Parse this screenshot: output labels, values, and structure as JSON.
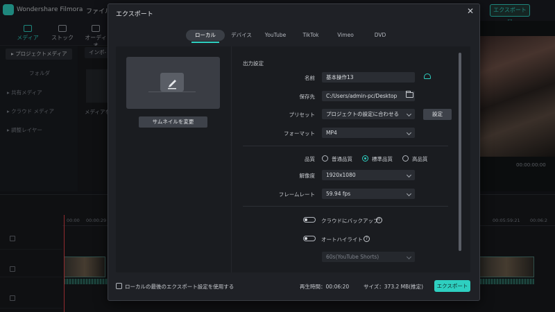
{
  "app": {
    "title": "Wondershare Filmora",
    "menu_file": "ファイル",
    "export_top": "エクスポート ▽"
  },
  "toolbar": {
    "media": "メディア",
    "stock": "ストック",
    "audio": "オーディオ"
  },
  "sidebar": {
    "items": [
      {
        "label": "▸ プロジェクトメディア"
      },
      {
        "label": "フォルダ"
      },
      {
        "label": "▸ 共有メディア"
      },
      {
        "label": "▸ クラウド メディア"
      },
      {
        "label": "▸ 調整レイヤー"
      }
    ]
  },
  "media_panel": {
    "import": "インポ-",
    "drop_hint": "メディアを"
  },
  "preview": {
    "timecode": "00:00:00:00"
  },
  "timeline": {
    "times": [
      "00:00",
      "00:00:29",
      "00:05:59:21",
      "00:06:2"
    ]
  },
  "dialog": {
    "title": "エクスポート",
    "close": "✕",
    "tabs": [
      {
        "label": "ローカル",
        "active": true
      },
      {
        "label": "デバイス"
      },
      {
        "label": "YouTube"
      },
      {
        "label": "TikTok"
      },
      {
        "label": "Vimeo"
      },
      {
        "label": "DVD"
      }
    ],
    "thumbnail_button": "サムネイルを変更",
    "section_title": "出力設定",
    "fields": {
      "name_label": "名前",
      "name_value": "基本操作13",
      "save_label": "保存先",
      "save_value": "C:/Users/admin-pc/Desktop",
      "preset_label": "プリセット",
      "preset_value": "プロジェクトの設定に合わせる",
      "settings_button": "設定",
      "format_label": "フォーマット",
      "format_value": "MP4",
      "quality_label": "品質",
      "quality_options": [
        "普通品質",
        "標準品質",
        "高品質"
      ],
      "quality_selected": "標準品質",
      "resolution_label": "解像度",
      "resolution_value": "1920x1080",
      "framerate_label": "フレームレート",
      "framerate_value": "59.94 fps",
      "cloud_backup_label": "クラウドにバックアップ",
      "auto_highlight_label": "オートハイライト",
      "highlight_value": "60s(YouTube Shorts)"
    },
    "footer": {
      "use_last_label": "ローカルの最後のエクスポート設定を使用する",
      "duration": "再生時間：00:06:20",
      "size": "サイズ：373.2 MB(推定)",
      "export_button": "エクスポート"
    }
  },
  "colors": {
    "accent": "#2ecfc0",
    "dialog_bg": "#1f2126",
    "panel_bg": "#1a1c20"
  }
}
